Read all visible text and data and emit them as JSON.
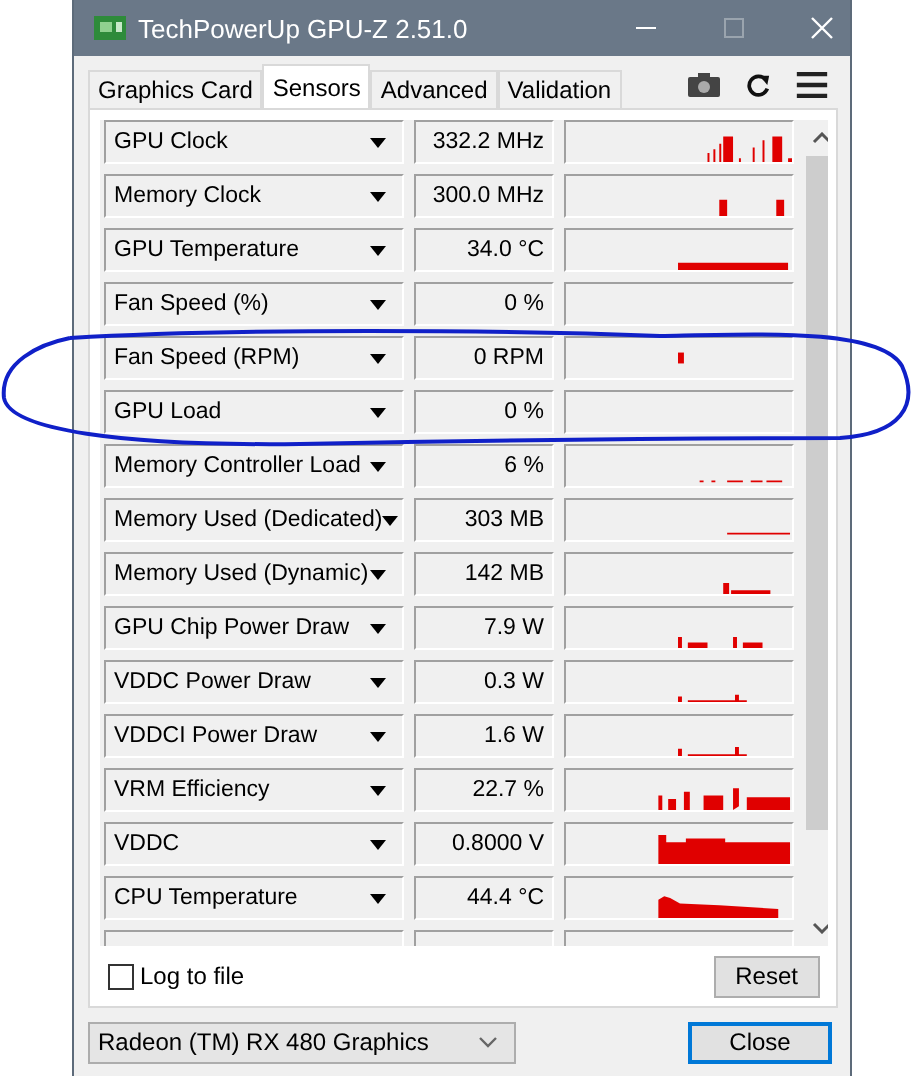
{
  "window": {
    "title": "TechPowerUp GPU-Z 2.51.0"
  },
  "tabs": [
    {
      "label": "Graphics Card",
      "selected": false
    },
    {
      "label": "Sensors",
      "selected": true
    },
    {
      "label": "Advanced",
      "selected": false
    },
    {
      "label": "Validation",
      "selected": false
    }
  ],
  "sensors": [
    {
      "name": "GPU Clock",
      "value": "332.2 MHz"
    },
    {
      "name": "Memory Clock",
      "value": "300.0 MHz"
    },
    {
      "name": "GPU Temperature",
      "value": "34.0 °C"
    },
    {
      "name": "Fan Speed (%)",
      "value": "0 %"
    },
    {
      "name": "Fan Speed (RPM)",
      "value": "0 RPM"
    },
    {
      "name": "GPU Load",
      "value": "0 %"
    },
    {
      "name": "Memory Controller Load",
      "value": "6 %"
    },
    {
      "name": "Memory Used (Dedicated)",
      "value": "303 MB"
    },
    {
      "name": "Memory Used (Dynamic)",
      "value": "142 MB"
    },
    {
      "name": "GPU Chip Power Draw",
      "value": "7.9 W"
    },
    {
      "name": "VDDC Power Draw",
      "value": "0.3 W"
    },
    {
      "name": "VDDCI Power Draw",
      "value": "1.6 W"
    },
    {
      "name": "VRM Efficiency",
      "value": "22.7 %"
    },
    {
      "name": "VDDC",
      "value": "0.8000 V"
    },
    {
      "name": "CPU Temperature",
      "value": "44.4 °C"
    }
  ],
  "log_to_file": {
    "label": "Log to file",
    "checked": false
  },
  "reset_button": "Reset",
  "device_select": {
    "value": "Radeon (TM) RX 480 Graphics"
  },
  "close_button": "Close"
}
